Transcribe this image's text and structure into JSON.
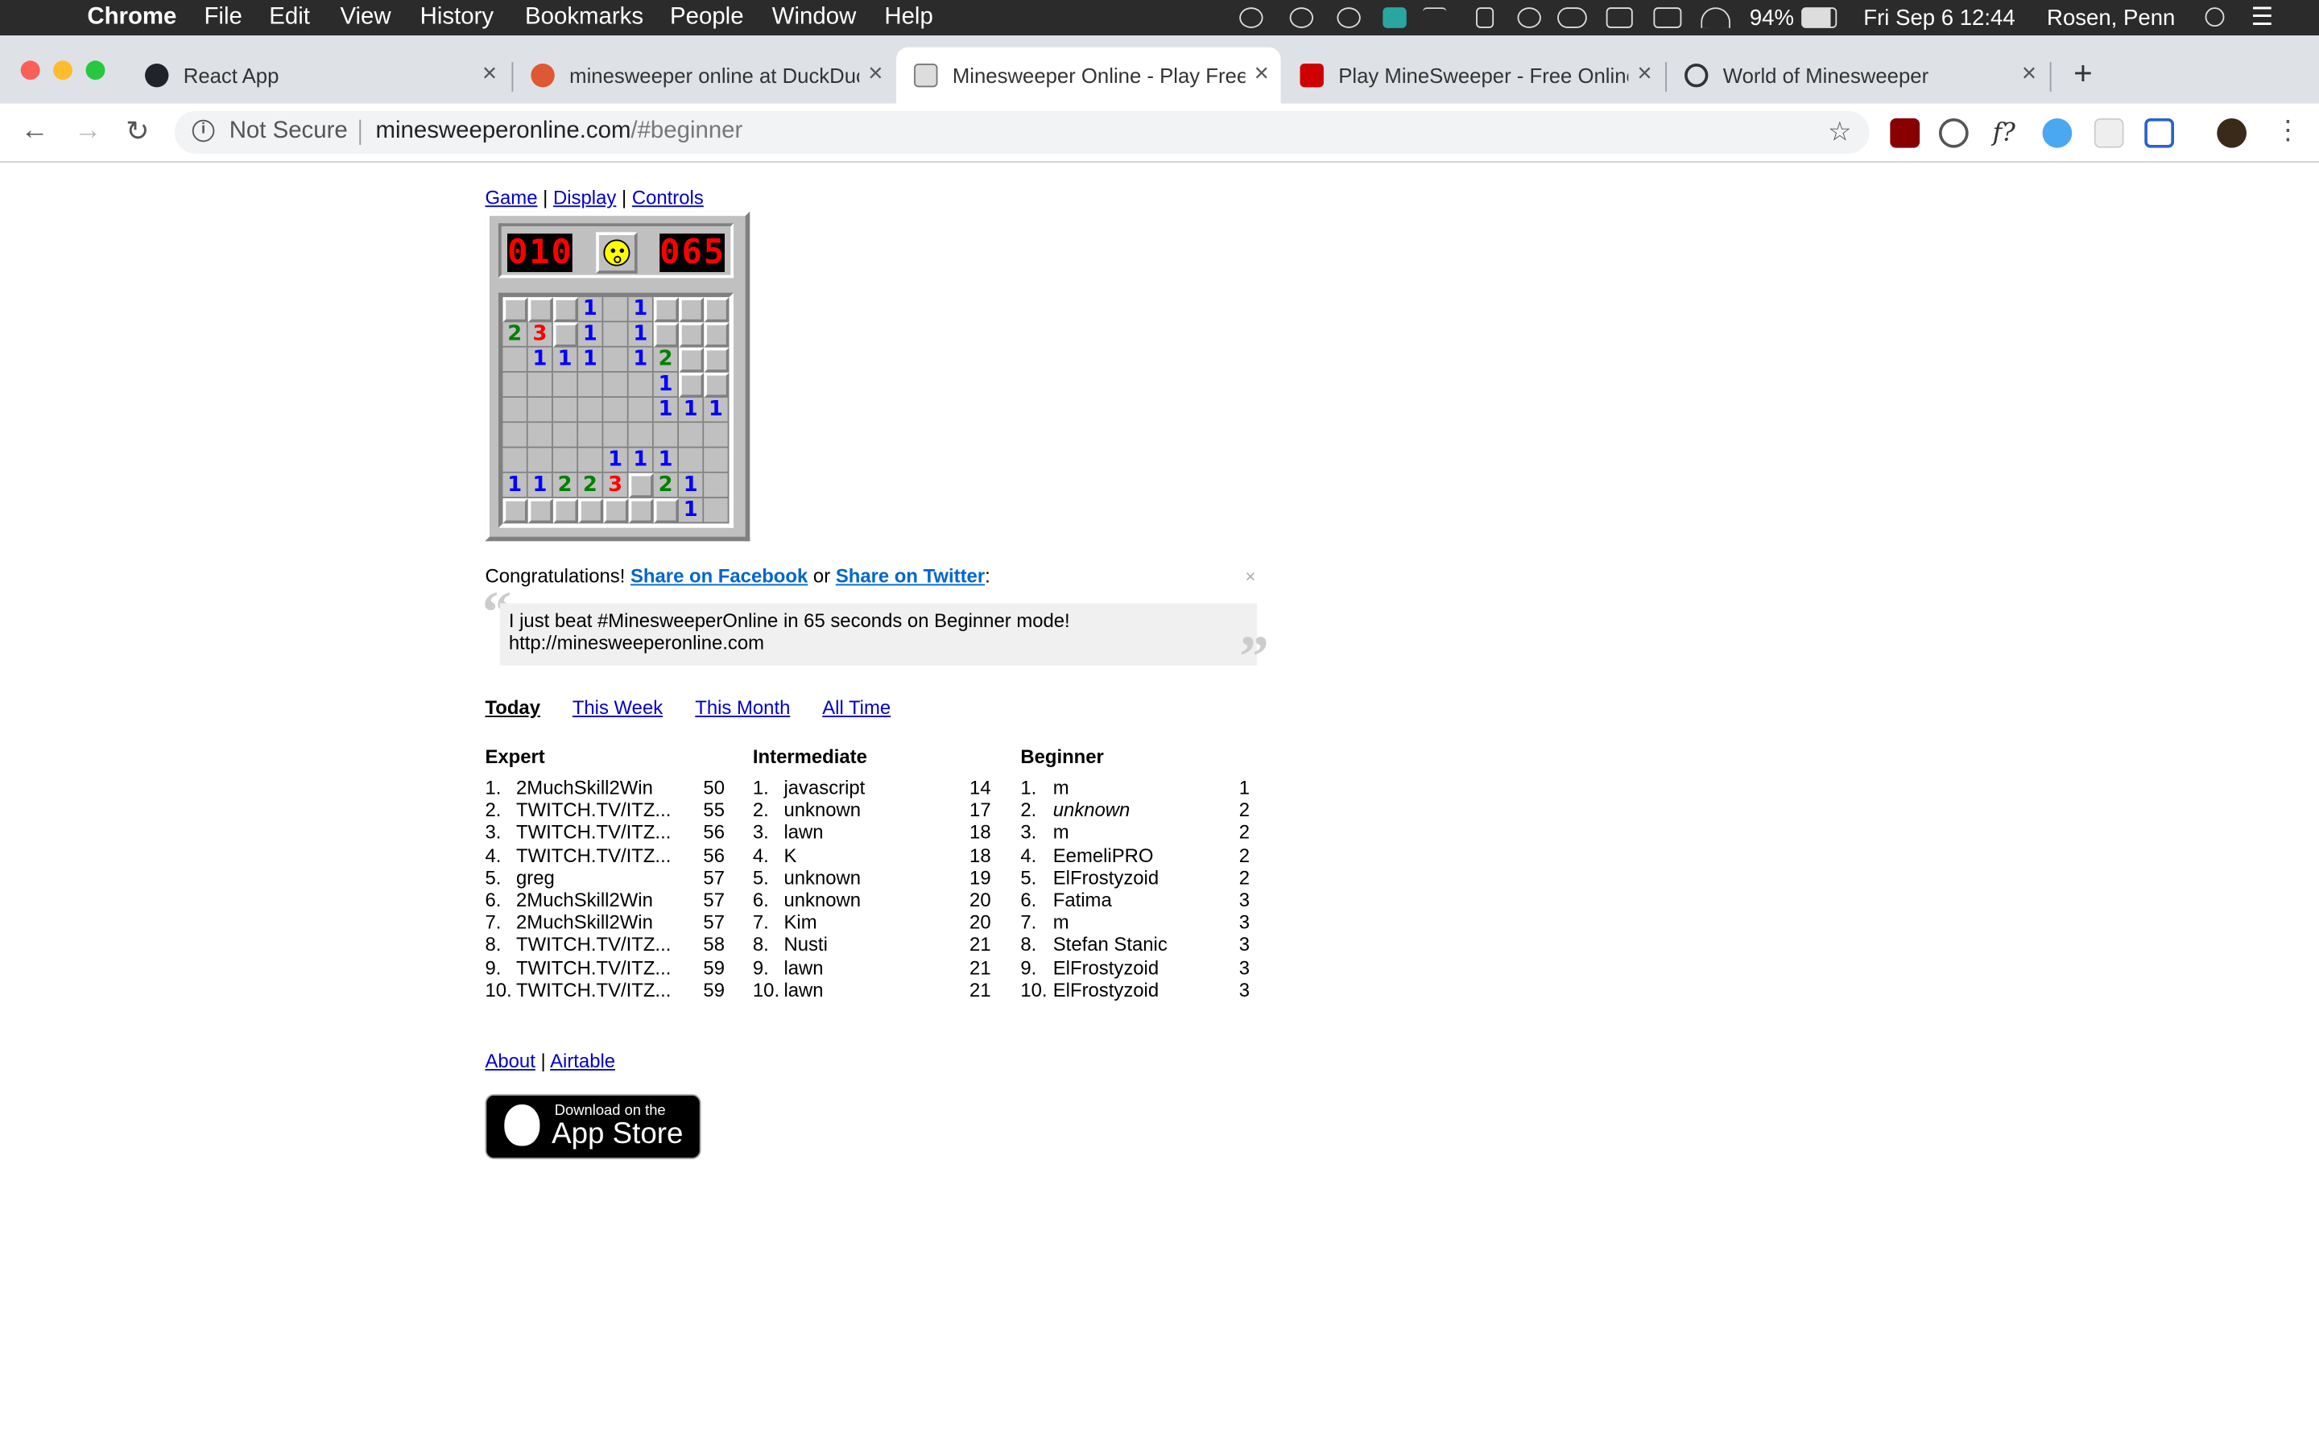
{
  "menubar": {
    "app": "Chrome",
    "items": [
      "File",
      "Edit",
      "View",
      "History",
      "Bookmarks",
      "People",
      "Window",
      "Help"
    ],
    "battery": "94%",
    "datetime": "Fri Sep 6  12:44",
    "user": "Rosen, Penn"
  },
  "tabs": [
    {
      "title": "React App",
      "favicon": "react-icon",
      "color": "#61dafb"
    },
    {
      "title": "minesweeper online at DuckDuckGo",
      "favicon": "duckduckgo-icon",
      "color": "#de5833"
    },
    {
      "title": "Minesweeper Online - Play Free Online Minesweeper",
      "favicon": "minesweeper-icon",
      "color": "#555555"
    },
    {
      "title": "Play MineSweeper - Free Online",
      "favicon": "mine-icon",
      "color": "#d00000"
    },
    {
      "title": "World of Minesweeper",
      "favicon": "settings-icon",
      "color": "#333333"
    }
  ],
  "active_tab": 2,
  "address": {
    "not_secure": "Not Secure",
    "domain": "minesweeperonline.com",
    "path": "/#beginner"
  },
  "page": {
    "nav": {
      "game": "Game",
      "display": "Display",
      "controls": "Controls",
      "sep": "|"
    },
    "mines_counter": "010",
    "timer": "065",
    "board": [
      [
        "C",
        "C",
        "C",
        "1",
        "O",
        "1",
        "C",
        "C",
        "C"
      ],
      [
        "2",
        "3",
        "C",
        "1",
        "O",
        "1",
        "C",
        "C",
        "C"
      ],
      [
        "O",
        "1",
        "1",
        "1",
        "O",
        "1",
        "2",
        "C",
        "C"
      ],
      [
        "O",
        "O",
        "O",
        "O",
        "O",
        "O",
        "1",
        "C",
        "C"
      ],
      [
        "O",
        "O",
        "O",
        "O",
        "O",
        "O",
        "1",
        "1",
        "1"
      ],
      [
        "O",
        "O",
        "O",
        "O",
        "O",
        "O",
        "O",
        "O",
        "O"
      ],
      [
        "O",
        "O",
        "O",
        "O",
        "1",
        "1",
        "1",
        "O",
        "O"
      ],
      [
        "1",
        "1",
        "2",
        "2",
        "3",
        "C",
        "2",
        "1",
        "O"
      ],
      [
        "C",
        "C",
        "C",
        "C",
        "C",
        "C",
        "C",
        "1",
        "O"
      ]
    ],
    "congrats": {
      "text": "Congratulations!",
      "facebook": "Share on Facebook",
      "or": "or",
      "twitter": "Share on Twitter",
      "colon": ":",
      "close": "×"
    },
    "share_line1": "I just beat #MinesweeperOnline in 65 seconds on Beginner mode!",
    "share_line2": "http://minesweeperonline.com",
    "quote_open": "“",
    "quote_close": "”",
    "periods": [
      "Today",
      "This Week",
      "This Month",
      "All Time"
    ],
    "columns": [
      "Expert",
      "Intermediate",
      "Beginner"
    ],
    "scores": {
      "expert": [
        {
          "rank": "1.",
          "name": "2MuchSkill2Win",
          "score": "50"
        },
        {
          "rank": "2.",
          "name": "TWITCH.TV/ITZ...",
          "score": "55"
        },
        {
          "rank": "3.",
          "name": "TWITCH.TV/ITZ...",
          "score": "56"
        },
        {
          "rank": "4.",
          "name": "TWITCH.TV/ITZ...",
          "score": "56"
        },
        {
          "rank": "5.",
          "name": "greg",
          "score": "57"
        },
        {
          "rank": "6.",
          "name": "2MuchSkill2Win",
          "score": "57"
        },
        {
          "rank": "7.",
          "name": "2MuchSkill2Win",
          "score": "57"
        },
        {
          "rank": "8.",
          "name": "TWITCH.TV/ITZ...",
          "score": "58"
        },
        {
          "rank": "9.",
          "name": "TWITCH.TV/ITZ...",
          "score": "59"
        },
        {
          "rank": "10.",
          "name": "TWITCH.TV/ITZ...",
          "score": "59"
        }
      ],
      "intermediate": [
        {
          "rank": "1.",
          "name": "javascript",
          "score": "14"
        },
        {
          "rank": "2.",
          "name": "unknown",
          "score": "17"
        },
        {
          "rank": "3.",
          "name": "lawn",
          "score": "18"
        },
        {
          "rank": "4.",
          "name": "K",
          "score": "18"
        },
        {
          "rank": "5.",
          "name": "unknown",
          "score": "19"
        },
        {
          "rank": "6.",
          "name": "unknown",
          "score": "20"
        },
        {
          "rank": "7.",
          "name": "Kim",
          "score": "20"
        },
        {
          "rank": "8.",
          "name": "Nusti",
          "score": "21"
        },
        {
          "rank": "9.",
          "name": "lawn",
          "score": "21"
        },
        {
          "rank": "10.",
          "name": "lawn",
          "score": "21"
        }
      ],
      "beginner": [
        {
          "rank": "1.",
          "name": "m",
          "score": "1"
        },
        {
          "rank": "2.",
          "name": "unknown",
          "score": "2",
          "italic": true
        },
        {
          "rank": "3.",
          "name": "m",
          "score": "2"
        },
        {
          "rank": "4.",
          "name": "EemeliPRO",
          "score": "2"
        },
        {
          "rank": "5.",
          "name": "ElFrostyzoid",
          "score": "2"
        },
        {
          "rank": "6.",
          "name": "Fatima",
          "score": "3"
        },
        {
          "rank": "7.",
          "name": "m",
          "score": "3"
        },
        {
          "rank": "8.",
          "name": "Stefan Stanic",
          "score": "3"
        },
        {
          "rank": "9.",
          "name": "ElFrostyzoid",
          "score": "3"
        },
        {
          "rank": "10.",
          "name": "ElFrostyzoid",
          "score": "3"
        }
      ]
    },
    "footer": {
      "about": "About",
      "sep": "|",
      "airtable": "Airtable"
    },
    "appstore": {
      "small": "Download on the",
      "big": "App Store"
    }
  }
}
